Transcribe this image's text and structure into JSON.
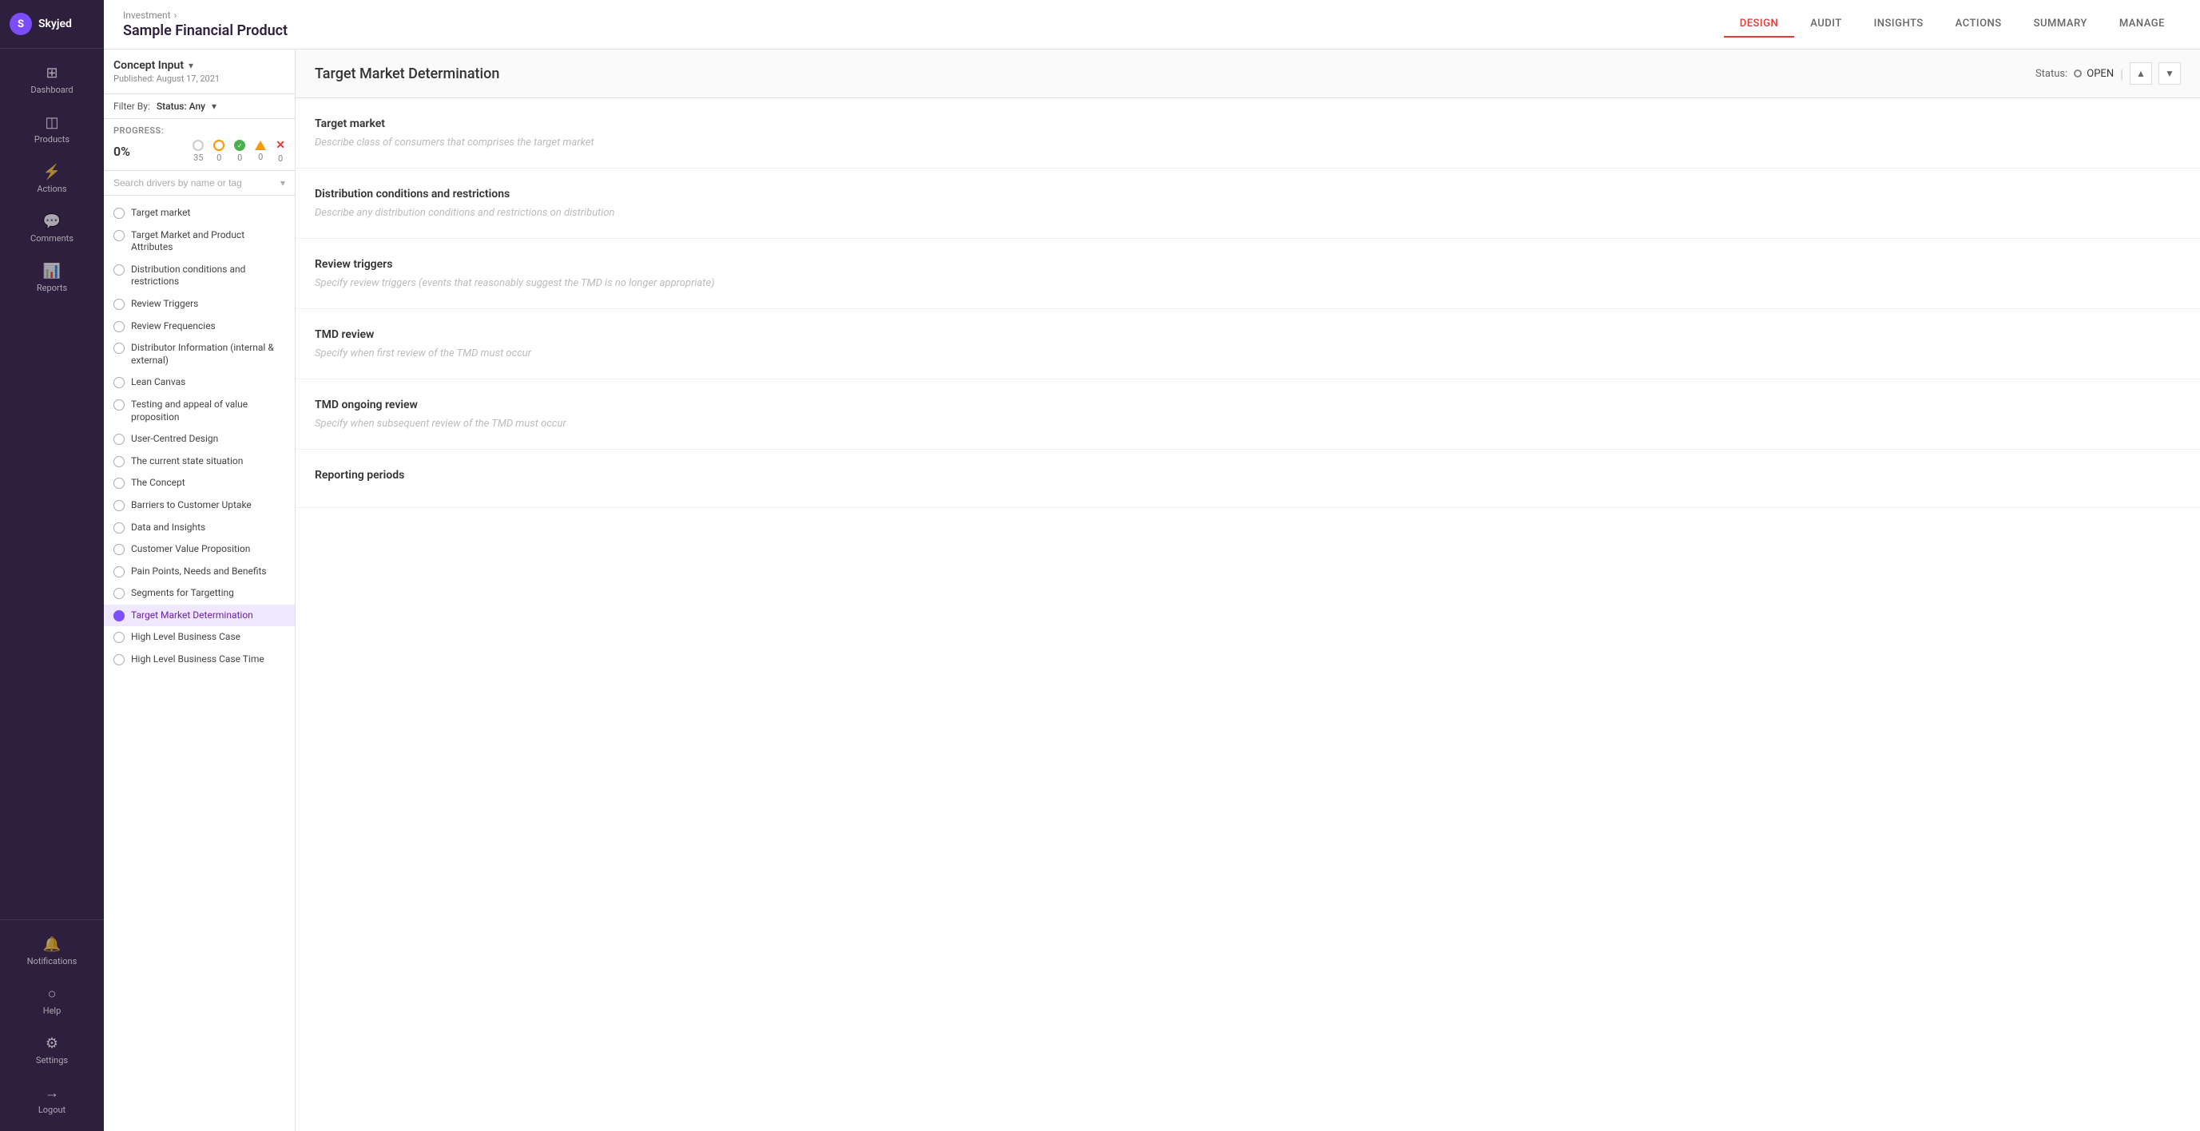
{
  "app": {
    "logo_text": "Skyjed",
    "logo_initial": "S"
  },
  "sidebar": {
    "items": [
      {
        "id": "dashboard",
        "label": "Dashboard",
        "icon": "⊞"
      },
      {
        "id": "products",
        "label": "Products",
        "icon": "◫"
      },
      {
        "id": "actions",
        "label": "Actions",
        "icon": "⚡"
      },
      {
        "id": "comments",
        "label": "Comments",
        "icon": "💬"
      },
      {
        "id": "reports",
        "label": "Reports",
        "icon": "📊"
      }
    ],
    "bottom_items": [
      {
        "id": "notifications",
        "label": "Notifications",
        "icon": "🔔"
      },
      {
        "id": "help",
        "label": "Help",
        "icon": "○"
      },
      {
        "id": "settings",
        "label": "Settings",
        "icon": "⚙"
      },
      {
        "id": "logout",
        "label": "Logout",
        "icon": "→"
      }
    ]
  },
  "header": {
    "breadcrumb": "Investment",
    "breadcrumb_arrow": "›",
    "page_title": "Sample Financial Product",
    "tabs": [
      {
        "id": "design",
        "label": "DESIGN",
        "active": true
      },
      {
        "id": "audit",
        "label": "AUDIT"
      },
      {
        "id": "insights",
        "label": "INSIGHTS"
      },
      {
        "id": "actions",
        "label": "ACTIONS"
      },
      {
        "id": "summary",
        "label": "SUMMARY"
      },
      {
        "id": "manage",
        "label": "MANAGE"
      }
    ]
  },
  "left_panel": {
    "concept_title": "Concept Input",
    "concept_date": "Published: August 17, 2021",
    "filter_label": "Filter By:",
    "filter_status": "Status: Any",
    "progress_label": "PROGRESS:",
    "progress_pct": "0%",
    "progress_counts": {
      "grey": "35",
      "orange": "0",
      "green": "0",
      "warning": "0",
      "error": "0"
    },
    "search_placeholder": "Search drivers by name or tag",
    "drivers": [
      {
        "id": "target-market",
        "label": "Target market",
        "active": false
      },
      {
        "id": "target-market-attributes",
        "label": "Target Market and Product Attributes",
        "active": false
      },
      {
        "id": "distribution-conditions",
        "label": "Distribution conditions and restrictions",
        "active": false
      },
      {
        "id": "review-triggers",
        "label": "Review Triggers",
        "active": false
      },
      {
        "id": "review-frequencies",
        "label": "Review Frequencies",
        "active": false
      },
      {
        "id": "distributor-info",
        "label": "Distributor Information (internal & external)",
        "active": false
      },
      {
        "id": "lean-canvas",
        "label": "Lean Canvas",
        "active": false
      },
      {
        "id": "testing-appeal",
        "label": "Testing and appeal of value proposition",
        "active": false
      },
      {
        "id": "user-centred",
        "label": "User-Centred Design",
        "active": false
      },
      {
        "id": "current-state",
        "label": "The current state situation",
        "active": false
      },
      {
        "id": "the-concept",
        "label": "The Concept",
        "active": false
      },
      {
        "id": "barriers",
        "label": "Barriers to Customer Uptake",
        "active": false
      },
      {
        "id": "data-insights",
        "label": "Data and Insights",
        "active": false
      },
      {
        "id": "customer-value",
        "label": "Customer Value Proposition",
        "active": false
      },
      {
        "id": "pain-points",
        "label": "Pain Points, Needs and Benefits",
        "active": false
      },
      {
        "id": "segments",
        "label": "Segments for Targetting",
        "active": false
      },
      {
        "id": "target-market-det",
        "label": "Target Market Determination",
        "active": true
      },
      {
        "id": "high-level-bc",
        "label": "High Level Business Case",
        "active": false
      },
      {
        "id": "high-level-bc-time",
        "label": "High Level Business Case Time",
        "active": false
      }
    ]
  },
  "main_section": {
    "title": "Target Market Determination",
    "status_label": "Status:",
    "status_value": "OPEN",
    "fields": [
      {
        "id": "target-market",
        "label": "Target market",
        "placeholder": "Describe class of consumers that comprises the target market"
      },
      {
        "id": "distribution-conditions",
        "label": "Distribution conditions and restrictions",
        "placeholder": "Describe any distribution conditions and restrictions on distribution"
      },
      {
        "id": "review-triggers",
        "label": "Review triggers",
        "placeholder": "Specify review triggers (events that reasonably suggest the TMD is no longer appropriate)"
      },
      {
        "id": "tmd-review",
        "label": "TMD review",
        "placeholder": "Specify when first review of the TMD must occur"
      },
      {
        "id": "tmd-ongoing-review",
        "label": "TMD ongoing review",
        "placeholder": "Specify when subsequent review of the TMD must occur"
      },
      {
        "id": "reporting-periods",
        "label": "Reporting periods",
        "placeholder": ""
      }
    ]
  }
}
